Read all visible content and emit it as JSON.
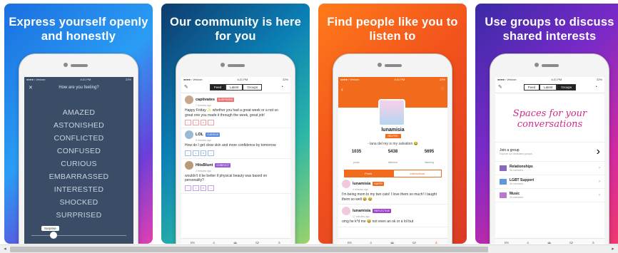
{
  "cards": [
    {
      "headline": "Express yourself openly and honestly"
    },
    {
      "headline": "Our community is here for you"
    },
    {
      "headline": "Find people like you to listen to"
    },
    {
      "headline": "Use groups to discuss shared interests"
    }
  ],
  "status_bar": {
    "carrier": "●●●●○ Verizon",
    "time": "4:21 PM",
    "battery": "22%"
  },
  "feelings_screen": {
    "title": "How are you feeling?",
    "close_icon": "close-icon",
    "moods": [
      "AMAZED",
      "ASTONISHED",
      "CONFLICTED",
      "CONFUSED",
      "CURIOUS",
      "EMBARRASSED",
      "INTERESTED",
      "SHOCKED",
      "SURPRISED"
    ],
    "slider_tooltip": "Surprise"
  },
  "feed_screen": {
    "tabs": [
      "Feed",
      "Latest",
      "Groups"
    ],
    "active_tab": "Feed",
    "posts": [
      {
        "name": "captivates",
        "badge": "SURPRISED",
        "ago": "7 minutes ago",
        "text": "Happy Friday ✨ whether you had a great week or a not so great one you made it through the week, great job!"
      },
      {
        "name": "LOL",
        "badge": "CURIOUS",
        "ago": "5 minutes ago",
        "text": "How do I get clear skin and more confidence by tomorrow"
      },
      {
        "name": "HitsBlunt",
        "badge": "CONFLICT",
        "ago": "2 minutes ago",
        "text": "wouldn't it be better if physical beauty was based on personality?"
      }
    ]
  },
  "profile_screen": {
    "name": "lunamisia",
    "role": "HELPER",
    "bio": "- lana del rey is my salvation 😂",
    "stats": [
      {
        "value": "1035",
        "label": "posts"
      },
      {
        "value": "5438",
        "label": "listeners"
      },
      {
        "value": "5695",
        "label": "listening"
      }
    ],
    "tabs": [
      "Posts",
      "Interactions"
    ],
    "posts": [
      {
        "name": "lunamisia",
        "badge": "HAPPY",
        "ago": "4 minutes ago",
        "text": "I'm being mom to my two cats! I love them so much! I taught them so well 😂 😂"
      },
      {
        "name": "lunamisia",
        "badge": "REFLECTIVE",
        "ago": "17 minutes ago",
        "text": "omg he k*d me 😂 not even an ok or a lol but"
      }
    ]
  },
  "groups_screen": {
    "tabs": [
      "Feed",
      "Latest",
      "Groups"
    ],
    "active_tab": "Groups",
    "banner": "Spaces for your conversations",
    "join": {
      "title": "Join a group",
      "subtitle": "Explore our dedicated groups"
    },
    "groups": [
      {
        "title": "Relationships",
        "subtitle": "3k members"
      },
      {
        "title": "LGBT Support",
        "subtitle": "3k members"
      },
      {
        "title": "Music",
        "subtitle": "2k members"
      }
    ]
  },
  "colors": {
    "orange": "#f26a1b",
    "feelings_bg": "#3b4d66",
    "group_pink": "#d02a8a"
  }
}
